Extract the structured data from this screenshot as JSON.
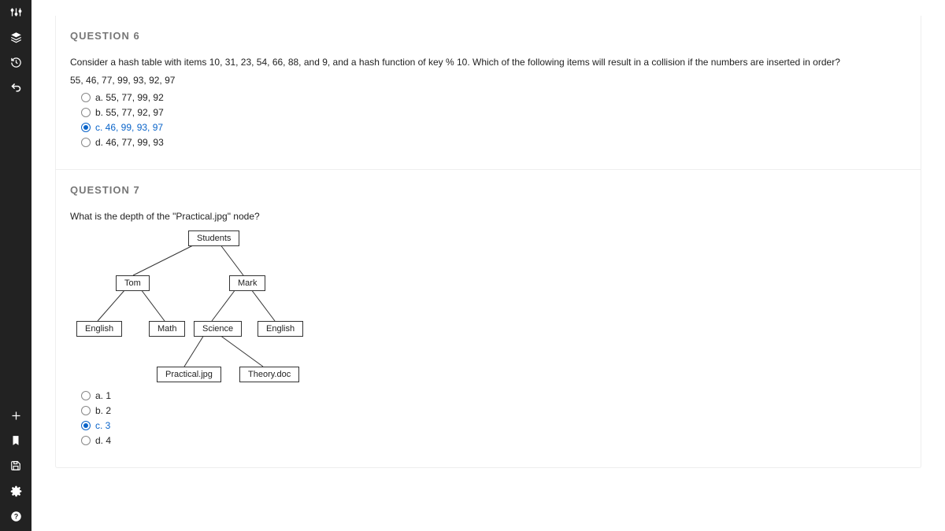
{
  "sidebar": {
    "items": [
      "sliders",
      "stack",
      "history",
      "undo"
    ],
    "bottom": [
      "plus",
      "bookmark",
      "save",
      "settings",
      "help"
    ]
  },
  "q6": {
    "heading": "QUESTION 6",
    "prompt": "Consider a hash table with items 10, 31, 23, 54, 66, 88, and 9, and a hash function of key % 10. Which of the following items will result in a collision if the numbers are inserted in order?",
    "subline": "55, 46, 77, 99, 93, 92, 97",
    "options": [
      {
        "label": "a. 55, 77, 99, 92",
        "selected": false
      },
      {
        "label": "b. 55, 77, 92, 97",
        "selected": false
      },
      {
        "label": "c. 46, 99, 93, 97",
        "selected": true
      },
      {
        "label": "d. 46, 77, 99, 93",
        "selected": false
      }
    ]
  },
  "q7": {
    "heading": "QUESTION 7",
    "prompt": "What is the depth of the \"Practical.jpg\" node?",
    "nodes": {
      "students": "Students",
      "tom": "Tom",
      "mark": "Mark",
      "english1": "English",
      "math": "Math",
      "science": "Science",
      "english2": "English",
      "practical": "Practical.jpg",
      "theory": "Theory.doc"
    },
    "options": [
      {
        "label": "a. 1",
        "selected": false
      },
      {
        "label": "b. 2",
        "selected": false
      },
      {
        "label": "c. 3",
        "selected": true
      },
      {
        "label": "d. 4",
        "selected": false
      }
    ]
  }
}
